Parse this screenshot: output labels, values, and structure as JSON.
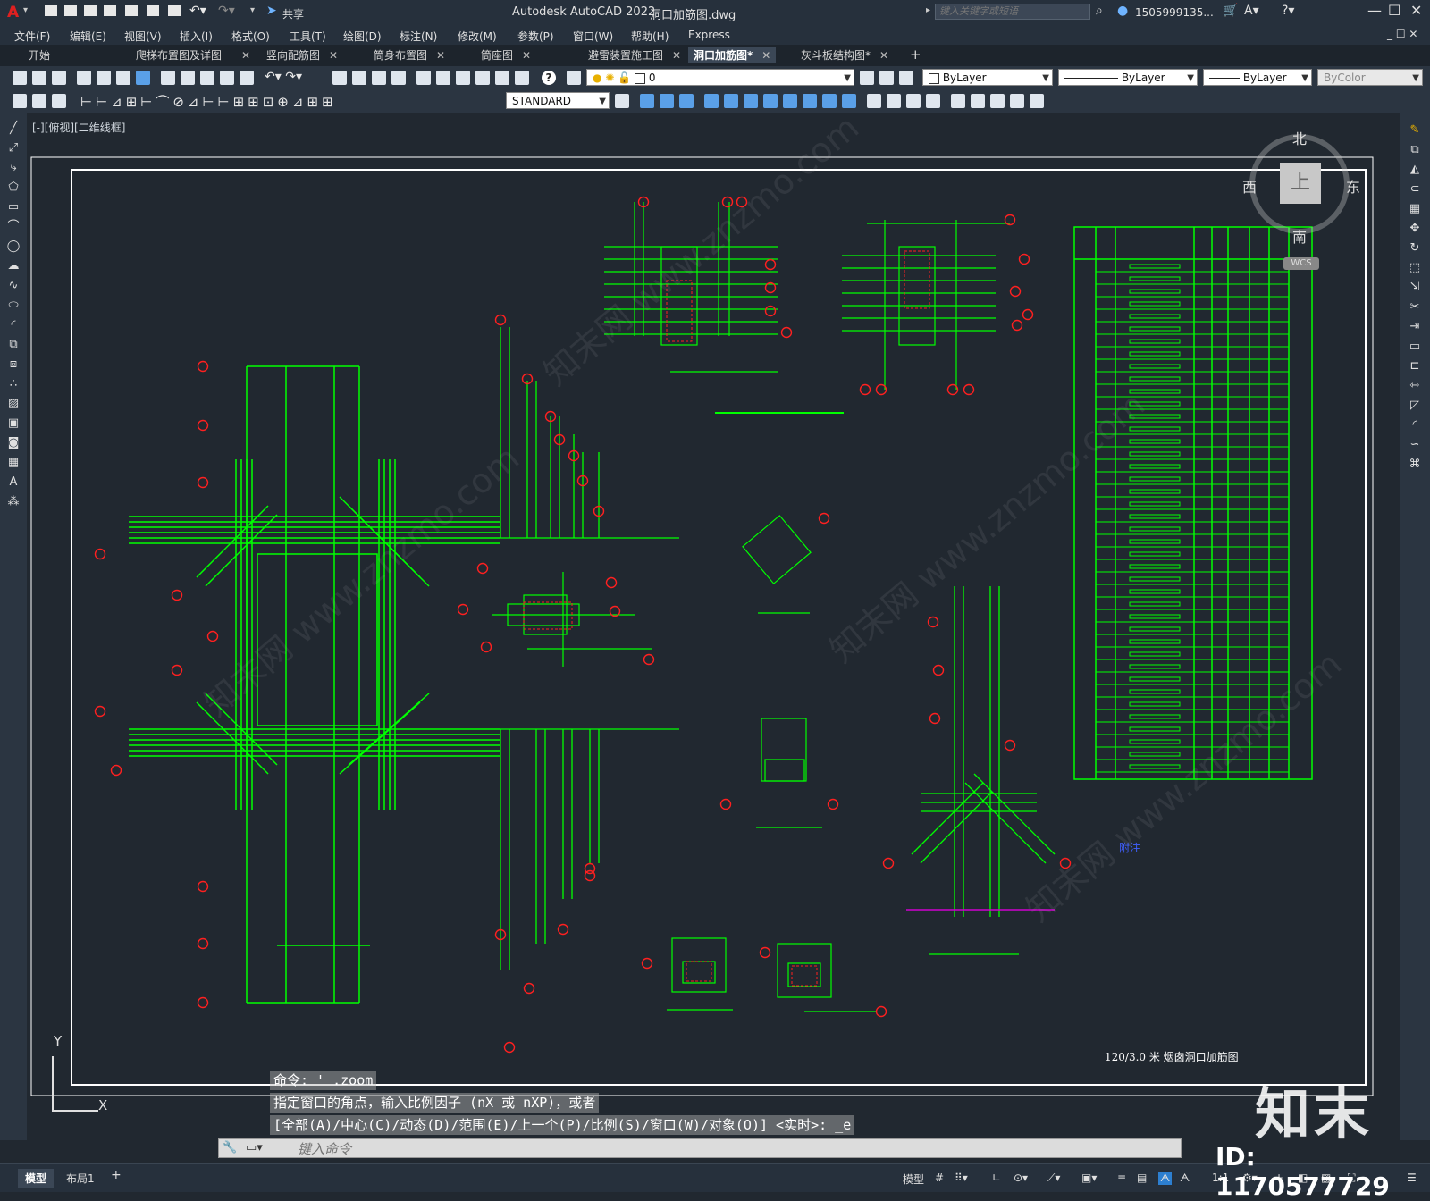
{
  "app": {
    "title": "Autodesk AutoCAD 2022",
    "file": "洞口加筋图.dwg",
    "share_label": "共享",
    "search_placeholder": "键入关键字或短语",
    "user": "1505999135...",
    "logo_letter": "A"
  },
  "menu": [
    "文件(F)",
    "编辑(E)",
    "视图(V)",
    "插入(I)",
    "格式(O)",
    "工具(T)",
    "绘图(D)",
    "标注(N)",
    "修改(M)",
    "参数(P)",
    "窗口(W)",
    "帮助(H)",
    "Express"
  ],
  "tabs": [
    {
      "label": "开始"
    },
    {
      "label": "爬梯布置图及详图一"
    },
    {
      "label": "竖向配筋图"
    },
    {
      "label": "筒身布置图"
    },
    {
      "label": "筒座图"
    },
    {
      "label": "避雷装置施工图"
    },
    {
      "label": "洞口加筋图*"
    },
    {
      "label": "灰斗板结构图*"
    }
  ],
  "active_tab": "洞口加筋图*",
  "properties": {
    "layer": "0",
    "color": "ByLayer",
    "linetype": "ByLayer",
    "lineweight": "ByLayer",
    "plotstyle": "ByColor",
    "textstyle": "STANDARD"
  },
  "viewport_label": "[-][俯视][二维线框]",
  "viewcube": {
    "north": "北",
    "south": "南",
    "east": "东",
    "west": "西",
    "top": "上",
    "wcs": "WCS"
  },
  "drawing": {
    "sheet_title": "120/3.0 米 烟囱洞口加筋图",
    "note_title": "附注"
  },
  "ucs": {
    "x": "X",
    "y": "Y"
  },
  "command": {
    "history": [
      "命令: '_.zoom",
      "指定窗口的角点，输入比例因子 (nX 或 nXP)，或者",
      "[全部(A)/中心(C)/动态(D)/范围(E)/上一个(P)/比例(S)/窗口(W)/对象(O)] <实时>: _e"
    ],
    "input_placeholder": "键入命令"
  },
  "layout_tabs": [
    "模型",
    "布局1"
  ],
  "status": {
    "model_label": "模型",
    "scale": "1:1"
  },
  "watermark": {
    "brand": "知末",
    "id": "ID: 1170577729",
    "site": "知末网 www.znzmo.com"
  },
  "colors": {
    "accent": "#00ff00",
    "marker": "#ff2020",
    "bg": "#212830",
    "annotation": "#2050ff"
  }
}
